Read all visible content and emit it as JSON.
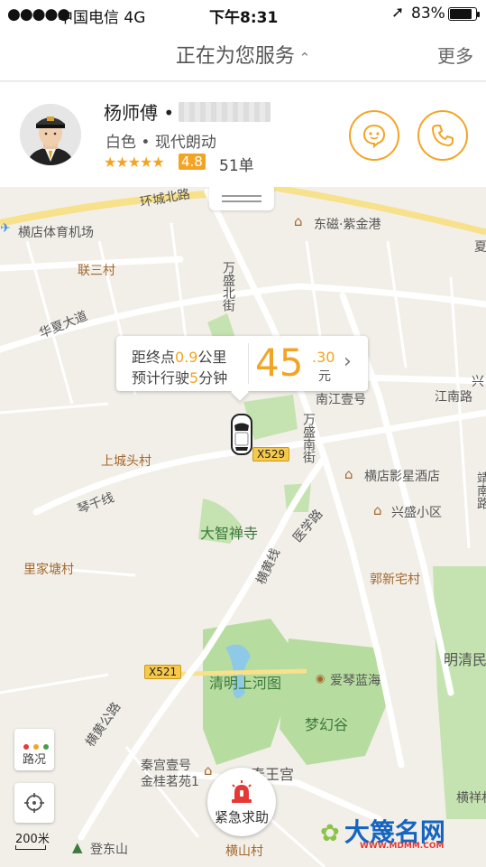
{
  "status_bar": {
    "signal": "●●●●●",
    "carrier": "中国电信  4G",
    "time": "下午8:31",
    "battery": "83%"
  },
  "header": {
    "title": "正在为您服务",
    "more": "更多"
  },
  "driver": {
    "name": "杨师傅 •",
    "car": "白色 • 现代朗动",
    "stars": "★★★★★",
    "rating": "4.8",
    "orders": "51单"
  },
  "trip": {
    "line1_prefix": "距终点",
    "distance": "0.9",
    "line1_suffix": "公里",
    "line2_prefix": "预计行驶",
    "minutes": "5",
    "line2_suffix": "分钟",
    "price": "45",
    "price_cents": ".30",
    "price_unit": "元"
  },
  "map": {
    "labels": {
      "huancheng": "环城北路",
      "airport": "横店体育机场",
      "dongci": "东磁·紫金港",
      "liansan": "联三村",
      "huaxia": "华夏大道",
      "wansheng_bei": "万盛北街",
      "nanjiang": "南江壹号",
      "jiangnan": "江南路",
      "shangchengtou": "上城头村",
      "x529": "X529",
      "wansheng_nan": "万盛南街",
      "yingxing": "横店影星酒店",
      "qianxian": "琴千线",
      "xingsheng": "兴盛小区",
      "dazhi": "大智禅寺",
      "yixue": "医学路",
      "lijiatang": "里家塘村",
      "guoxinzhai": "郭新宅村",
      "hengqian": "横黄线",
      "mingqing": "明清民",
      "x521": "X521",
      "qingming": "清明上河图",
      "aiqin": "爱琴蓝海",
      "menghuan": "梦幻谷",
      "henghuang": "横黄公路",
      "qingong1": "秦宫壹号",
      "qingong2": "金桂茗苑1",
      "qinwang": "秦王宫",
      "dengdong": "登东山",
      "hengshan": "横山村",
      "hengxiang": "横祥村",
      "xia": "夏",
      "xing": "兴",
      "jing": "靖南路"
    },
    "traffic_label": "路况",
    "scale": "200米",
    "sos": "紧急求助",
    "watermark": "大篾名网",
    "watermark_url": "WWW.MDMM.COM"
  },
  "colors": {
    "accent": "#f4a423",
    "map_bg": "#f2efe9",
    "park": "#b7dca0",
    "water": "#8ec9e8",
    "road_yellow": "#f7e18a"
  }
}
